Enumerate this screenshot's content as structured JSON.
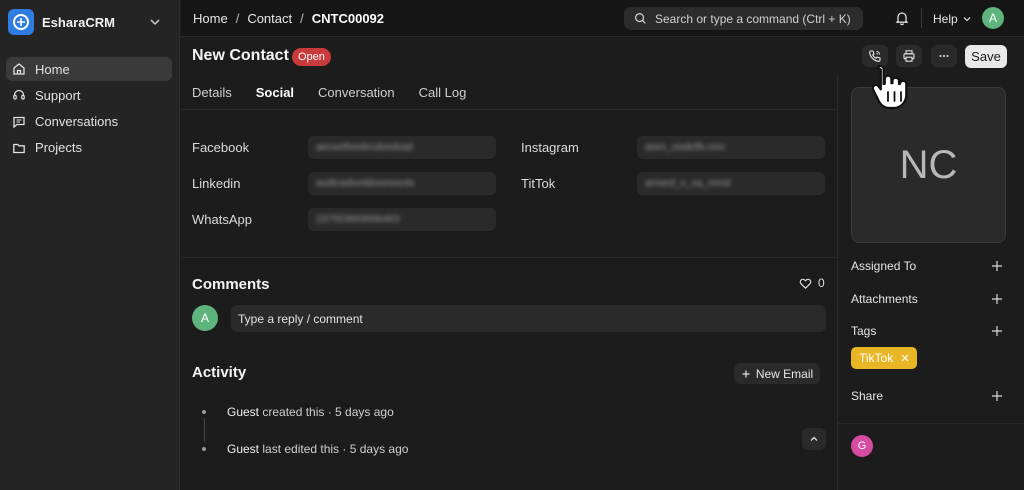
{
  "app": {
    "name": "EsharaCRM"
  },
  "sidebar": {
    "items": [
      {
        "label": "Home",
        "icon": "home-icon",
        "active": true
      },
      {
        "label": "Support",
        "icon": "headset-icon",
        "active": false
      },
      {
        "label": "Conversations",
        "icon": "message-icon",
        "active": false
      },
      {
        "label": "Projects",
        "icon": "folder-icon",
        "active": false
      }
    ]
  },
  "topbar": {
    "breadcrumbs": [
      "Home",
      "Contact",
      "CNTC00092"
    ],
    "search_placeholder": "Search or type a command (Ctrl + K)",
    "help_label": "Help",
    "user_initial": "A"
  },
  "header": {
    "title": "New Contact",
    "status": "Open",
    "save_label": "Save"
  },
  "tabs": [
    {
      "label": "Details",
      "active": false
    },
    {
      "label": "Social",
      "active": true
    },
    {
      "label": "Conversation",
      "active": false
    },
    {
      "label": "Call Log",
      "active": false
    }
  ],
  "social": {
    "facebook": {
      "label": "Facebook",
      "value": "aecsetfsedecdsedsad"
    },
    "linkedin": {
      "label": "Linkedin",
      "value": "asdtcadseddssesseds"
    },
    "whatsapp": {
      "label": "WhatsApp",
      "value": "237553669966463"
    },
    "instagram": {
      "label": "Instagram",
      "value": "asim_stsdcffs.nnn"
    },
    "tiktok": {
      "label": "TitTok",
      "value": "amsed_n_xa_nnnd"
    }
  },
  "comments": {
    "title": "Comments",
    "like_count": "0",
    "avatar_initial": "A",
    "reply_placeholder": "Type a reply / comment"
  },
  "activity": {
    "title": "Activity",
    "new_email_label": "New Email",
    "events": [
      {
        "who": "Guest",
        "text": " created this · 5 days ago"
      },
      {
        "who": "Guest",
        "text": " last edited this · 5 days ago"
      }
    ]
  },
  "right_panel": {
    "photo_initials": "NC",
    "assigned_to_label": "Assigned To",
    "attachments_label": "Attachments",
    "tags_label": "Tags",
    "tag_value": "TikTok",
    "share_label": "Share",
    "share_user_initial": "G"
  },
  "colors": {
    "accent_blue": "#2f7de1",
    "status_red": "#c93a3a",
    "tag_yellow": "#e9b625",
    "avatar_green": "#5fb37c",
    "avatar_pink": "#d64ca1"
  }
}
